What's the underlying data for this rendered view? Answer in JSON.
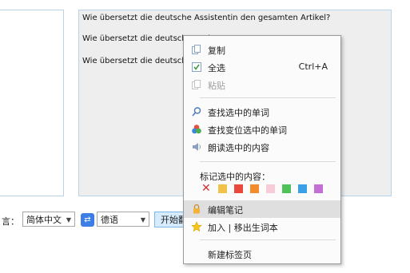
{
  "editor": {
    "lines": [
      "Wie übersetzt die deutsche Assistentin den gesamten Artikel?",
      "Wie übersetzt die deutsche Assi",
      "Wie übersetzt die deutsche Assi"
    ]
  },
  "toolbar": {
    "lang_label": "言：",
    "source_language": "简体中文",
    "target_language": "德语",
    "start_label": "开始翻"
  },
  "context_menu": {
    "items": [
      {
        "label": "复制",
        "icon": "copy-icon",
        "enabled": true
      },
      {
        "label": "全选",
        "icon": "select-all-icon",
        "shortcut": "Ctrl+A",
        "enabled": true
      },
      {
        "label": "粘贴",
        "icon": "paste-icon",
        "enabled": false
      },
      {
        "label": "查找选中的单词",
        "icon": "search-icon",
        "enabled": true
      },
      {
        "label": "查找变位选中的单词",
        "icon": "conjugation-icon",
        "enabled": true
      },
      {
        "label": "朗读选中的内容",
        "icon": "speaker-icon",
        "enabled": true
      },
      {
        "label": "编辑笔记",
        "icon": "lock-icon",
        "enabled": true,
        "hover": true
      },
      {
        "label": "加入 | 移出生词本",
        "icon": "star-icon",
        "enabled": true
      },
      {
        "label": "新建标签页",
        "enabled": true
      }
    ],
    "mark_title": "标记选中的内容：",
    "mark_colors": [
      "#f0c24a",
      "#e8493a",
      "#f28c2c",
      "#f7cbd8",
      "#4fc35a",
      "#3aa0e8",
      "#c46fd6"
    ]
  }
}
